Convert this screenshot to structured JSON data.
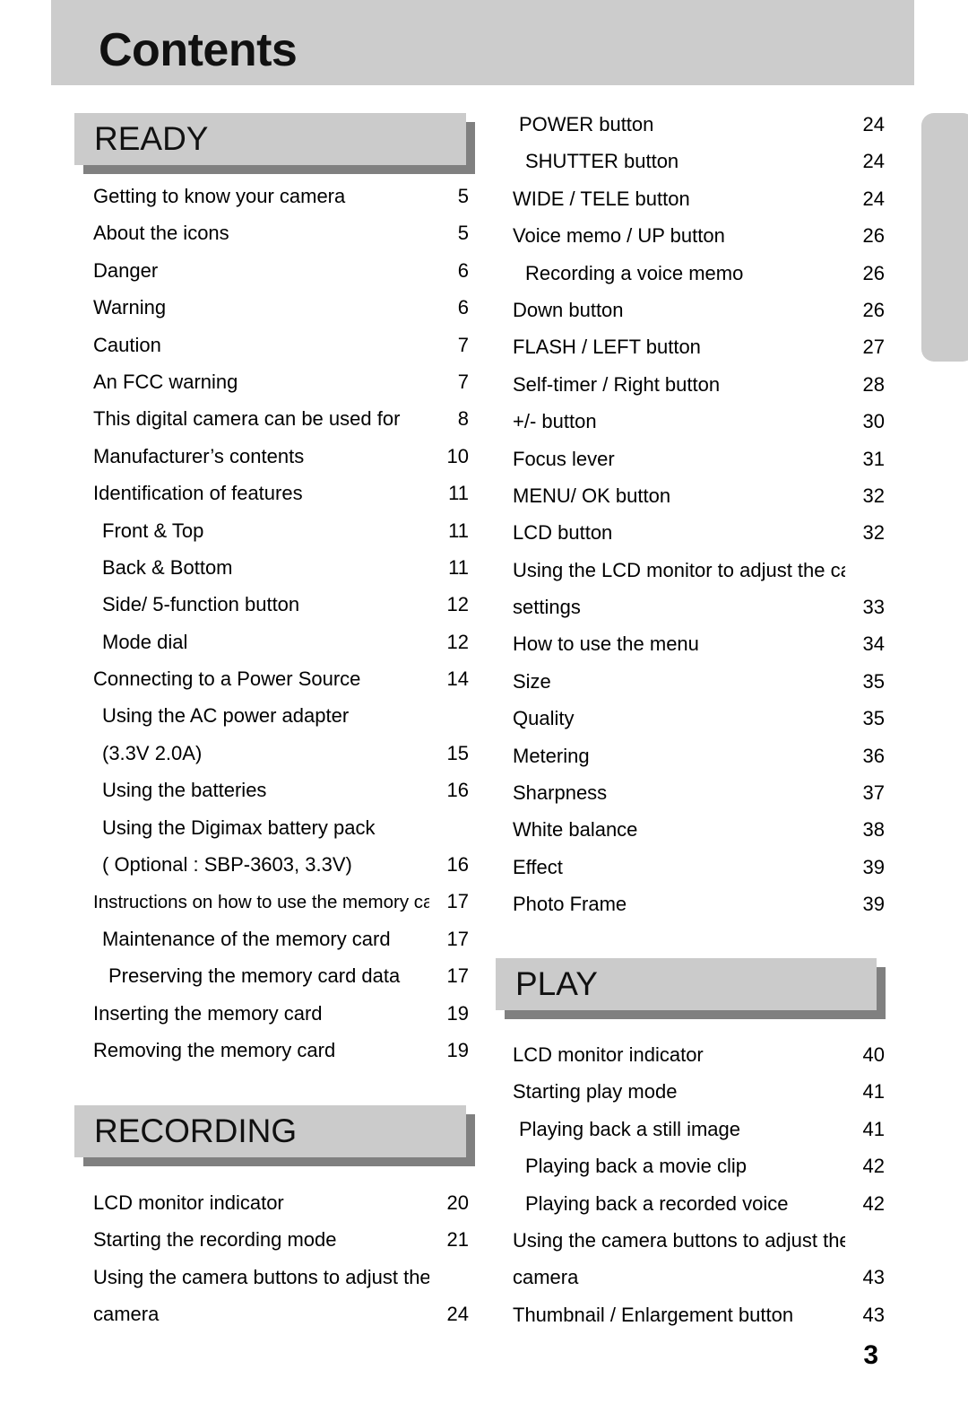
{
  "page": {
    "title": "Contents",
    "folio": "3",
    "colors": {
      "band": "#cccccc",
      "banner_fill": "#cbcbcb",
      "banner_shadow": "#808080",
      "text": "#000000"
    }
  },
  "sections": {
    "ready": {
      "label": "READY"
    },
    "recording": {
      "label": "RECORDING"
    },
    "play": {
      "label": "PLAY"
    }
  },
  "toc": {
    "ready": [
      {
        "title": "Getting to know your camera",
        "page": "5",
        "level": 0
      },
      {
        "title": "About the icons",
        "page": "5",
        "level": 0
      },
      {
        "title": "Danger",
        "page": "6",
        "level": 0
      },
      {
        "title": "Warning",
        "page": "6",
        "level": 0
      },
      {
        "title": "Caution",
        "page": "7",
        "level": 0
      },
      {
        "title": "An FCC warning",
        "page": "7",
        "level": 0
      },
      {
        "title": "This digital camera can be used for",
        "page": "8",
        "level": 0
      },
      {
        "title": "Manufacturer’s contents",
        "page": "10",
        "level": 0
      },
      {
        "title": "Identification of features",
        "page": "11",
        "level": 0
      },
      {
        "title": "Front & Top",
        "page": "11",
        "level": 1
      },
      {
        "title": "Back & Bottom",
        "page": "11",
        "level": 1
      },
      {
        "title": "Side/ 5-function button",
        "page": "12",
        "level": 1
      },
      {
        "title": "Mode dial",
        "page": "12",
        "level": 1
      },
      {
        "title": "Connecting to a Power Source",
        "page": "14",
        "level": 0
      },
      {
        "title": "Using the AC power adapter",
        "page": "",
        "level": 1
      },
      {
        "title": "(3.3V 2.0A)",
        "page": "15",
        "level": 1
      },
      {
        "title": "Using the batteries",
        "page": "16",
        "level": 1
      },
      {
        "title": "Using the Digimax battery pack",
        "page": "",
        "level": 1
      },
      {
        "title": "( Optional : SBP-3603, 3.3V)",
        "page": "16",
        "level": 1
      },
      {
        "title": "Instructions on how to use the memory card",
        "page": "17",
        "level": 0,
        "small": true
      },
      {
        "title": "Maintenance of the memory card",
        "page": "17",
        "level": 1
      },
      {
        "title": "Preserving the memory card data",
        "page": "17",
        "level": 2
      },
      {
        "title": "Inserting the memory card",
        "page": "19",
        "level": 0
      },
      {
        "title": "Removing the memory card",
        "page": "19",
        "level": 0
      }
    ],
    "recording": [
      {
        "title": "LCD monitor indicator",
        "page": "20",
        "level": 0
      },
      {
        "title": "Starting the recording mode",
        "page": "21",
        "level": 0
      },
      {
        "title": "Using the camera buttons to adjust the",
        "page": "",
        "level": 0
      },
      {
        "title": "camera",
        "page": "24",
        "level": 0
      }
    ],
    "right_column": [
      {
        "title": "POWER button",
        "page": "24",
        "level": 1
      },
      {
        "title": "SHUTTER button",
        "page": "24",
        "level": 2
      },
      {
        "title": "WIDE / TELE button",
        "page": "24",
        "level": 0
      },
      {
        "title": "Voice memo / UP button",
        "page": "26",
        "level": 0
      },
      {
        "title": "Recording a voice memo",
        "page": "26",
        "level": 2
      },
      {
        "title": "Down button",
        "page": "26",
        "level": 0
      },
      {
        "title": "FLASH / LEFT button",
        "page": "27",
        "level": 0
      },
      {
        "title": "Self-timer / Right button",
        "page": "28",
        "level": 0
      },
      {
        "title": "+/- button",
        "page": "30",
        "level": 0
      },
      {
        "title": "Focus lever",
        "page": "31",
        "level": 0
      },
      {
        "title": "MENU/ OK button",
        "page": "32",
        "level": 0
      },
      {
        "title": "LCD button",
        "page": "32",
        "level": 0
      },
      {
        "title": "Using the LCD monitor to adjust the camera",
        "page": "",
        "level": 0
      },
      {
        "title": "settings",
        "page": "33",
        "level": 0
      },
      {
        "title": "How to use the menu",
        "page": "34",
        "level": 0
      },
      {
        "title": "Size",
        "page": "35",
        "level": 0
      },
      {
        "title": "Quality",
        "page": "35",
        "level": 0
      },
      {
        "title": "Metering",
        "page": "36",
        "level": 0
      },
      {
        "title": "Sharpness",
        "page": "37",
        "level": 0
      },
      {
        "title": "White balance",
        "page": "38",
        "level": 0
      },
      {
        "title": "Effect",
        "page": "39",
        "level": 0
      },
      {
        "title": "Photo Frame",
        "page": "39",
        "level": 0
      }
    ],
    "play": [
      {
        "title": "LCD monitor indicator",
        "page": "40",
        "level": 0
      },
      {
        "title": "Starting play mode",
        "page": "41",
        "level": 0
      },
      {
        "title": "Playing back a still image",
        "page": "41",
        "level": 1
      },
      {
        "title": "Playing back a movie clip",
        "page": "42",
        "level": 2
      },
      {
        "title": "Playing back a recorded voice",
        "page": "42",
        "level": 2
      },
      {
        "title": "Using the camera buttons to adjust the",
        "page": "",
        "level": 0
      },
      {
        "title": "camera",
        "page": "43",
        "level": 0
      },
      {
        "title": "Thumbnail / Enlargement button",
        "page": "43",
        "level": 0
      }
    ]
  }
}
